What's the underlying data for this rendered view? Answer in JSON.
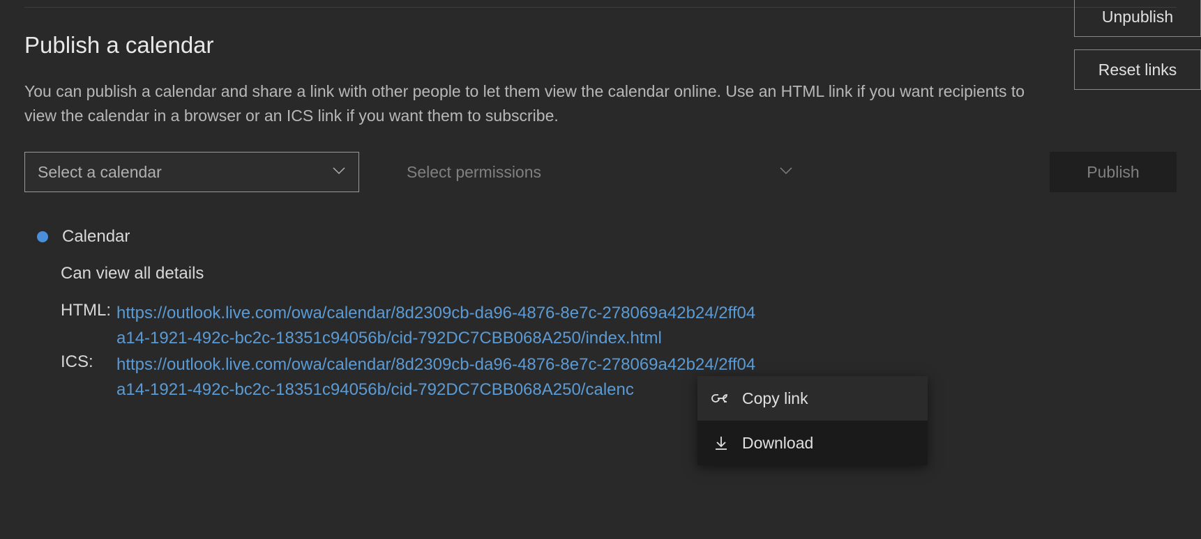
{
  "header": {
    "title": "Publish a calendar",
    "description": "You can publish a calendar and share a link with other people to let them view the calendar online. Use an HTML link if you want recipients to view the calendar in a browser or an ICS link if you want them to subscribe."
  },
  "controls": {
    "calendar_placeholder": "Select a calendar",
    "permissions_placeholder": "Select permissions",
    "publish_label": "Publish"
  },
  "published": {
    "calendar_name": "Calendar",
    "permission_level": "Can view all details",
    "html_label": "HTML:",
    "html_url": "https://outlook.live.com/owa/calendar/8d2309cb-da96-4876-8e7c-278069a42b24/2ff04a14-1921-492c-bc2c-18351c94056b/cid-792DC7CBB068A250/index.html",
    "ics_label": "ICS:",
    "ics_url": "https://outlook.live.com/owa/calendar/8d2309cb-da96-4876-8e7c-278069a42b24/2ff04a14-1921-492c-bc2c-18351c94056b/cid-792DC7CBB068A250/calenc",
    "unpublish_label": "Unpublish",
    "reset_label": "Reset links"
  },
  "context_menu": {
    "copy_link": "Copy link",
    "download": "Download"
  }
}
